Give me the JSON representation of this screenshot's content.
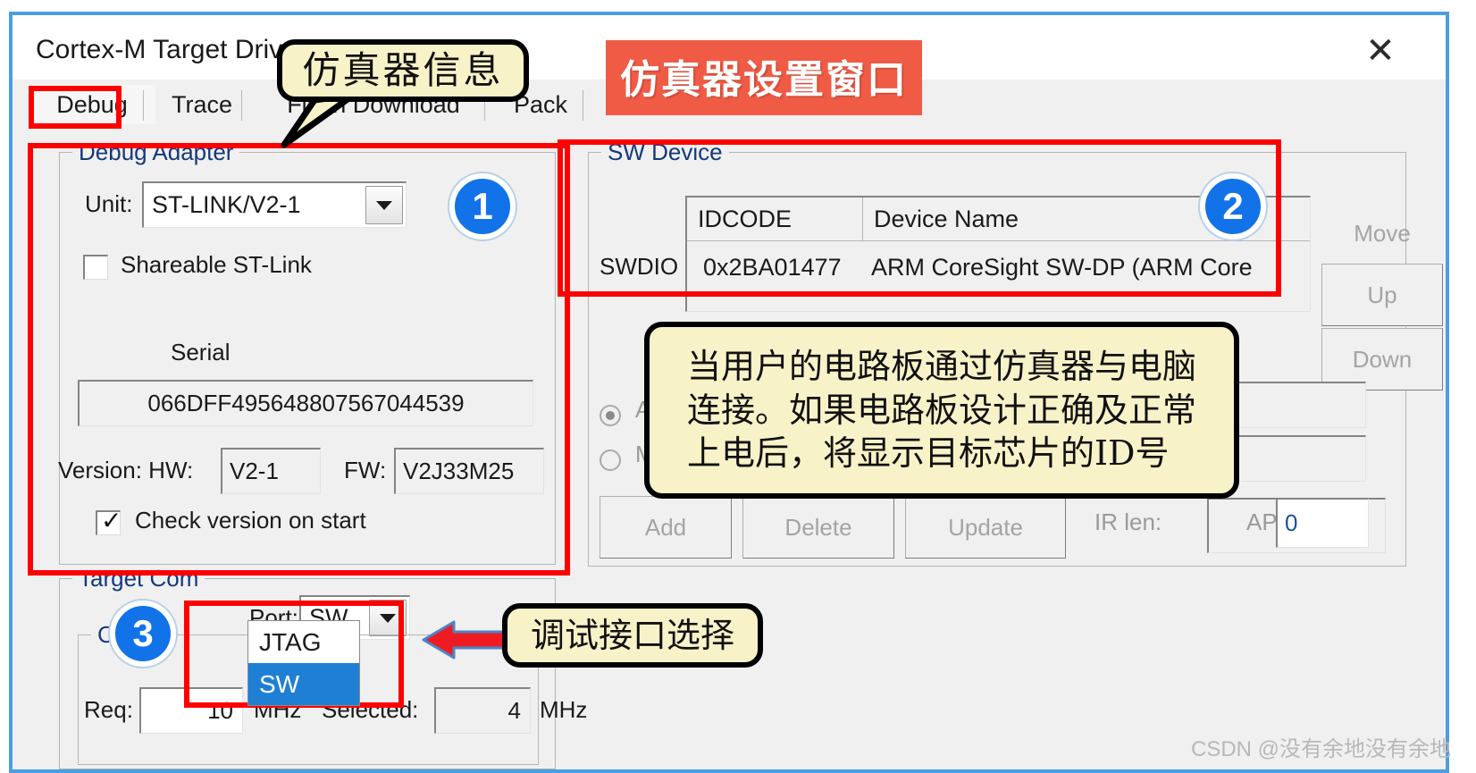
{
  "window": {
    "title": "Cortex-M Target Driver Setup",
    "close_icon": "close-icon"
  },
  "tabs": [
    {
      "label": "Debug",
      "active": true
    },
    {
      "label": "Trace",
      "active": false
    },
    {
      "label": "Flash Download",
      "active": false
    },
    {
      "label": "Pack",
      "active": false
    }
  ],
  "debug_adapter": {
    "group_title": "Debug Adapter",
    "unit_label": "Unit:",
    "unit_value": "ST-LINK/V2-1",
    "shareable_label": "Shareable ST-Link",
    "shareable_checked": false,
    "serial_label": "Serial",
    "serial_value": "066DFF495648807567044539",
    "version_label": "Version: HW:",
    "hw_value": "V2-1",
    "fw_label": "FW:",
    "fw_value": "V2J33M25",
    "check_version_label": "Check version on start",
    "check_version_checked": true
  },
  "target_com": {
    "group_title": "Target Com",
    "port_label": "Port:",
    "port_value": "SW",
    "port_options": [
      "JTAG",
      "SW"
    ],
    "port_selected_option": "SW",
    "clock_title": "Clock",
    "req_label": "Req:",
    "req_value": "10",
    "req_unit": "MHz",
    "selected_label": "Selected:",
    "selected_value": "4",
    "selected_unit": "MHz"
  },
  "sw_device": {
    "group_title": "SW Device",
    "row_label": "SWDIO",
    "columns": [
      "IDCODE",
      "Device Name"
    ],
    "rows": [
      {
        "idcode": "0x2BA01477",
        "device_name": "ARM CoreSight SW-DP (ARM Core"
      }
    ],
    "move_label": "Move",
    "up_label": "Up",
    "down_label": "Down",
    "auto_label": "Auto",
    "auto_selected": true,
    "manual_label": "Manual",
    "manual_selected": false,
    "add_label": "Add",
    "delete_label": "Delete",
    "update_label": "Update",
    "ir_len_label": "IR len:",
    "ir_len_value": "",
    "ap_label": "AP:",
    "ap_value": "0"
  },
  "annotations": {
    "red_title": "仿真器设置窗口",
    "callout_emulator_info": "仿真器信息",
    "callout_idcode": "当用户的电路板通过仿真器与电脑\n连接。如果电路板设计正确及正常\n上电后，将显示目标芯片的ID号",
    "callout_port_select": "调试接口选择",
    "badge_1": "1",
    "badge_2": "2",
    "badge_3": "3",
    "arrow_icon": "left-arrow-icon",
    "accent_red": "#ff0000",
    "accent_blue": "#1273e8",
    "title_bg": "#ef5b45",
    "callout_bg": "#f8f2c8"
  },
  "watermark": "CSDN @没有余地没有余地"
}
